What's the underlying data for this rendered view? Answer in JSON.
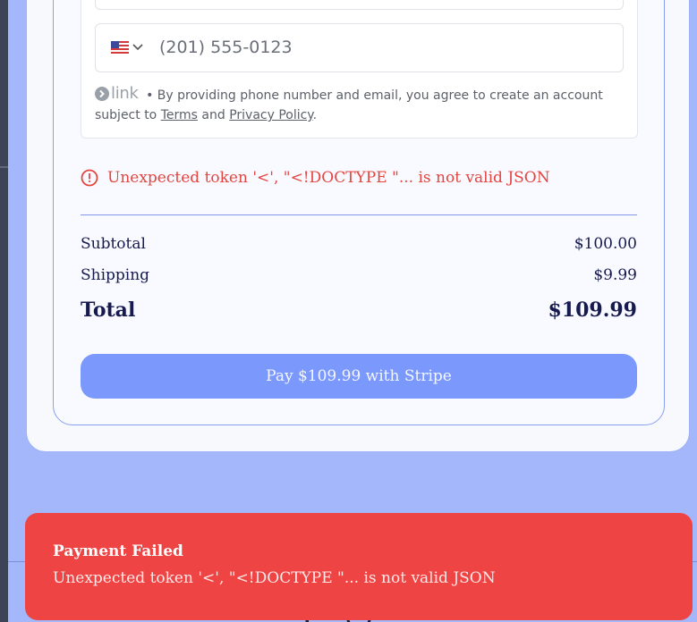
{
  "contact": {
    "phone_value": "(201) 555-0123",
    "country": "US",
    "consent_prefix": "• By providing phone number and email, you agree to create an account subject to",
    "terms_label": "Terms",
    "and_label": "and",
    "privacy_label": "Privacy Policy",
    "end_punct": ".",
    "link_brand": "link"
  },
  "error": {
    "message": "Unexpected token '<', \"<!DOCTYPE \"... is not valid JSON"
  },
  "summary": {
    "subtotal_label": "Subtotal",
    "subtotal_value": "$100.00",
    "shipping_label": "Shipping",
    "shipping_value": "$9.99",
    "total_label": "Total",
    "total_value": "$109.99"
  },
  "pay_button": {
    "label": "Pay $109.99 with Stripe"
  },
  "toast": {
    "title": "Payment Failed",
    "message": "Unexpected token '<', \"<!DOCTYPE \"... is not valid JSON"
  },
  "colors": {
    "accent": "#7b99fc",
    "error": "#e5443f",
    "toast_bg": "#ef4444",
    "page_bg": "#a4b7fb"
  },
  "icons": [
    "us-flag-icon",
    "chevron-down-icon",
    "link-arrow-icon",
    "error-circle-icon",
    "footer-social-icons"
  ]
}
